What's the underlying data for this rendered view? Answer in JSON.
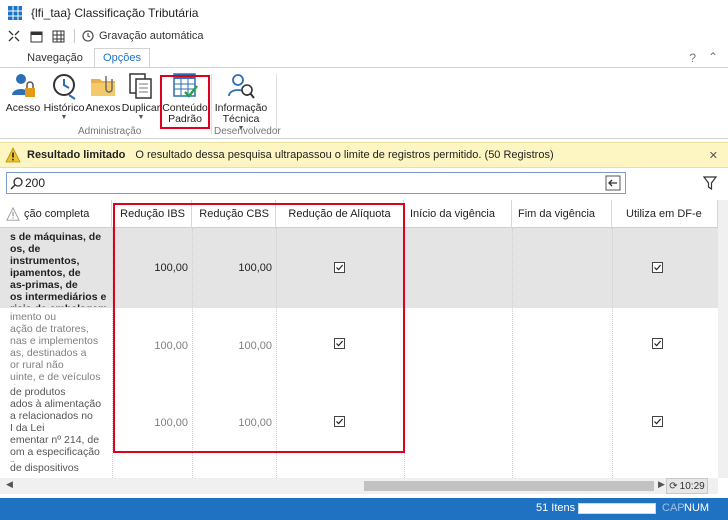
{
  "window": {
    "title": "{lfi_taa} Classificação Tributária"
  },
  "quick_access": {
    "autosave_label": "Gravação automática"
  },
  "tabs": [
    {
      "label": "Navegação",
      "active": false
    },
    {
      "label": "Opções",
      "active": true
    }
  ],
  "help_label": "?",
  "ribbon": {
    "buttons": [
      {
        "label": "Acesso",
        "icon": "user-lock-icon"
      },
      {
        "label": "Histórico",
        "icon": "history-clock-icon",
        "dropdown": true
      },
      {
        "label": "Anexos",
        "icon": "folder-attachment-icon"
      },
      {
        "label": "Duplicar",
        "icon": "duplicate-icon",
        "dropdown": true
      },
      {
        "label": "Conteúdo Padrão",
        "icon": "default-content-table-icon"
      },
      {
        "label": "Informação Técnica",
        "icon": "technical-info-icon",
        "dropdown": true
      }
    ],
    "groups": [
      "Administração",
      "Desenvolvedor"
    ]
  },
  "warning": {
    "title": "Resultado limitado",
    "message": "O resultado dessa pesquisa ultrapassou o limite de registros permitido. (50 Registros)"
  },
  "search": {
    "value": "200"
  },
  "grid": {
    "columns": [
      "ção completa",
      "Redução IBS",
      "Redução CBS",
      "Redução de Alíquota",
      "Início da vigência",
      "Fim da vigência",
      "Utiliza em DF-e"
    ],
    "rows": [
      {
        "description": "s de máquinas, de\nos, de instrumentos,\nipamentos, de\nas-primas, de\nos intermediários e\nriais de embalagem\nl",
        "reducao_ibs": "100,00",
        "reducao_cbs": "100,00",
        "reducao_aliquota": true,
        "inicio": "",
        "fim": "",
        "utiliza_dfe": true,
        "selected": true
      },
      {
        "description": "imento ou\nação de tratores,\nnas e implementos\nas, destinados a\nor rural não\nuinte, e de veículos\nd",
        "reducao_ibs": "100,00",
        "reducao_cbs": "100,00",
        "reducao_aliquota": true,
        "inicio": "",
        "fim": "",
        "utiliza_dfe": true,
        "selected": false
      },
      {
        "description": "de produtos\nados à alimentação\na relacionados no\nI da Lei\nementar nº 214, de\nom a especificação\nn",
        "reducao_ibs": "100,00",
        "reducao_cbs": "100,00",
        "reducao_aliquota": true,
        "inicio": "",
        "fim": "",
        "utiliza_dfe": true,
        "selected": false
      },
      {
        "description": "de dispositivos",
        "reducao_ibs": "",
        "reducao_cbs": "",
        "reducao_aliquota": false,
        "inicio": "",
        "fim": "",
        "utiliza_dfe": false,
        "selected": false
      }
    ]
  },
  "footer": {
    "refresh_label": "10:29"
  },
  "status": {
    "items": "51 Itens",
    "cap": "CAP",
    "num": "NUM"
  },
  "colors": {
    "accent": "#1c73c7",
    "statusbar": "#1f72c1",
    "warning_bg": "#fdf6c3",
    "highlight": "#e0001b",
    "selected_row": "#e4e4e4"
  }
}
